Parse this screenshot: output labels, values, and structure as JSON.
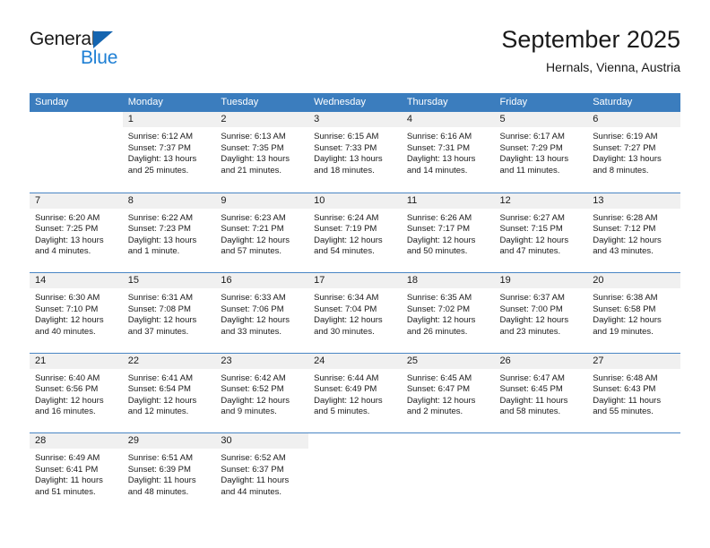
{
  "brand": {
    "name_part1": "General",
    "name_part2": "Blue",
    "logo_icon": "triangle-logo-icon",
    "accent_color": "#1e7fd4",
    "triangle_color": "#1565b0"
  },
  "header": {
    "title": "September 2025",
    "subtitle": "Hernals, Vienna, Austria"
  },
  "calendar": {
    "header_bg": "#3b7dbe",
    "daynum_bg": "#f0f0f0",
    "row_divider": "#4a86c5",
    "weekdays": [
      "Sunday",
      "Monday",
      "Tuesday",
      "Wednesday",
      "Thursday",
      "Friday",
      "Saturday"
    ],
    "weeks": [
      [
        {
          "day": "",
          "lines": []
        },
        {
          "day": "1",
          "lines": [
            "Sunrise: 6:12 AM",
            "Sunset: 7:37 PM",
            "Daylight: 13 hours",
            "and 25 minutes."
          ]
        },
        {
          "day": "2",
          "lines": [
            "Sunrise: 6:13 AM",
            "Sunset: 7:35 PM",
            "Daylight: 13 hours",
            "and 21 minutes."
          ]
        },
        {
          "day": "3",
          "lines": [
            "Sunrise: 6:15 AM",
            "Sunset: 7:33 PM",
            "Daylight: 13 hours",
            "and 18 minutes."
          ]
        },
        {
          "day": "4",
          "lines": [
            "Sunrise: 6:16 AM",
            "Sunset: 7:31 PM",
            "Daylight: 13 hours",
            "and 14 minutes."
          ]
        },
        {
          "day": "5",
          "lines": [
            "Sunrise: 6:17 AM",
            "Sunset: 7:29 PM",
            "Daylight: 13 hours",
            "and 11 minutes."
          ]
        },
        {
          "day": "6",
          "lines": [
            "Sunrise: 6:19 AM",
            "Sunset: 7:27 PM",
            "Daylight: 13 hours",
            "and 8 minutes."
          ]
        }
      ],
      [
        {
          "day": "7",
          "lines": [
            "Sunrise: 6:20 AM",
            "Sunset: 7:25 PM",
            "Daylight: 13 hours",
            "and 4 minutes."
          ]
        },
        {
          "day": "8",
          "lines": [
            "Sunrise: 6:22 AM",
            "Sunset: 7:23 PM",
            "Daylight: 13 hours",
            "and 1 minute."
          ]
        },
        {
          "day": "9",
          "lines": [
            "Sunrise: 6:23 AM",
            "Sunset: 7:21 PM",
            "Daylight: 12 hours",
            "and 57 minutes."
          ]
        },
        {
          "day": "10",
          "lines": [
            "Sunrise: 6:24 AM",
            "Sunset: 7:19 PM",
            "Daylight: 12 hours",
            "and 54 minutes."
          ]
        },
        {
          "day": "11",
          "lines": [
            "Sunrise: 6:26 AM",
            "Sunset: 7:17 PM",
            "Daylight: 12 hours",
            "and 50 minutes."
          ]
        },
        {
          "day": "12",
          "lines": [
            "Sunrise: 6:27 AM",
            "Sunset: 7:15 PM",
            "Daylight: 12 hours",
            "and 47 minutes."
          ]
        },
        {
          "day": "13",
          "lines": [
            "Sunrise: 6:28 AM",
            "Sunset: 7:12 PM",
            "Daylight: 12 hours",
            "and 43 minutes."
          ]
        }
      ],
      [
        {
          "day": "14",
          "lines": [
            "Sunrise: 6:30 AM",
            "Sunset: 7:10 PM",
            "Daylight: 12 hours",
            "and 40 minutes."
          ]
        },
        {
          "day": "15",
          "lines": [
            "Sunrise: 6:31 AM",
            "Sunset: 7:08 PM",
            "Daylight: 12 hours",
            "and 37 minutes."
          ]
        },
        {
          "day": "16",
          "lines": [
            "Sunrise: 6:33 AM",
            "Sunset: 7:06 PM",
            "Daylight: 12 hours",
            "and 33 minutes."
          ]
        },
        {
          "day": "17",
          "lines": [
            "Sunrise: 6:34 AM",
            "Sunset: 7:04 PM",
            "Daylight: 12 hours",
            "and 30 minutes."
          ]
        },
        {
          "day": "18",
          "lines": [
            "Sunrise: 6:35 AM",
            "Sunset: 7:02 PM",
            "Daylight: 12 hours",
            "and 26 minutes."
          ]
        },
        {
          "day": "19",
          "lines": [
            "Sunrise: 6:37 AM",
            "Sunset: 7:00 PM",
            "Daylight: 12 hours",
            "and 23 minutes."
          ]
        },
        {
          "day": "20",
          "lines": [
            "Sunrise: 6:38 AM",
            "Sunset: 6:58 PM",
            "Daylight: 12 hours",
            "and 19 minutes."
          ]
        }
      ],
      [
        {
          "day": "21",
          "lines": [
            "Sunrise: 6:40 AM",
            "Sunset: 6:56 PM",
            "Daylight: 12 hours",
            "and 16 minutes."
          ]
        },
        {
          "day": "22",
          "lines": [
            "Sunrise: 6:41 AM",
            "Sunset: 6:54 PM",
            "Daylight: 12 hours",
            "and 12 minutes."
          ]
        },
        {
          "day": "23",
          "lines": [
            "Sunrise: 6:42 AM",
            "Sunset: 6:52 PM",
            "Daylight: 12 hours",
            "and 9 minutes."
          ]
        },
        {
          "day": "24",
          "lines": [
            "Sunrise: 6:44 AM",
            "Sunset: 6:49 PM",
            "Daylight: 12 hours",
            "and 5 minutes."
          ]
        },
        {
          "day": "25",
          "lines": [
            "Sunrise: 6:45 AM",
            "Sunset: 6:47 PM",
            "Daylight: 12 hours",
            "and 2 minutes."
          ]
        },
        {
          "day": "26",
          "lines": [
            "Sunrise: 6:47 AM",
            "Sunset: 6:45 PM",
            "Daylight: 11 hours",
            "and 58 minutes."
          ]
        },
        {
          "day": "27",
          "lines": [
            "Sunrise: 6:48 AM",
            "Sunset: 6:43 PM",
            "Daylight: 11 hours",
            "and 55 minutes."
          ]
        }
      ],
      [
        {
          "day": "28",
          "lines": [
            "Sunrise: 6:49 AM",
            "Sunset: 6:41 PM",
            "Daylight: 11 hours",
            "and 51 minutes."
          ]
        },
        {
          "day": "29",
          "lines": [
            "Sunrise: 6:51 AM",
            "Sunset: 6:39 PM",
            "Daylight: 11 hours",
            "and 48 minutes."
          ]
        },
        {
          "day": "30",
          "lines": [
            "Sunrise: 6:52 AM",
            "Sunset: 6:37 PM",
            "Daylight: 11 hours",
            "and 44 minutes."
          ]
        },
        {
          "day": "",
          "lines": []
        },
        {
          "day": "",
          "lines": []
        },
        {
          "day": "",
          "lines": []
        },
        {
          "day": "",
          "lines": []
        }
      ]
    ]
  }
}
